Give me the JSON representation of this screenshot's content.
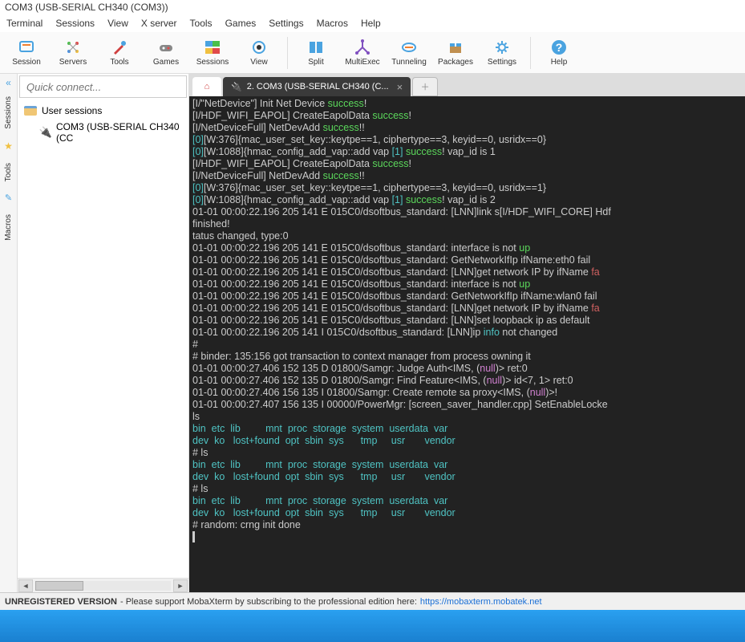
{
  "title": "COM3  (USB-SERIAL CH340 (COM3))",
  "menubar": [
    "Terminal",
    "Sessions",
    "View",
    "X server",
    "Tools",
    "Games",
    "Settings",
    "Macros",
    "Help"
  ],
  "toolbar": [
    {
      "label": "Session",
      "name": "session-button"
    },
    {
      "label": "Servers",
      "name": "servers-button"
    },
    {
      "label": "Tools",
      "name": "tools-button"
    },
    {
      "label": "Games",
      "name": "games-button"
    },
    {
      "label": "Sessions",
      "name": "sessions-button"
    },
    {
      "label": "View",
      "name": "view-button"
    },
    {
      "label": "Split",
      "name": "split-button"
    },
    {
      "label": "MultiExec",
      "name": "multiexec-button"
    },
    {
      "label": "Tunneling",
      "name": "tunneling-button"
    },
    {
      "label": "Packages",
      "name": "packages-button"
    },
    {
      "label": "Settings",
      "name": "settings-button"
    },
    {
      "label": "Help",
      "name": "help-button"
    }
  ],
  "quickconnect_placeholder": "Quick connect...",
  "sidetabs": [
    "Sessions",
    "Tools",
    "Macros"
  ],
  "tree": {
    "root": "User sessions",
    "child": "COM3  (USB-SERIAL CH340 (CC"
  },
  "tabs": {
    "active": "2. COM3  (USB-SERIAL CH340 (C..."
  },
  "terminal_lines": [
    [
      {
        "t": "[I/\"NetDevice\"] Init Net Device "
      },
      {
        "t": "success",
        "c": "g"
      },
      {
        "t": "!"
      }
    ],
    [
      {
        "t": "[I/HDF_WIFI_EAPOL] CreateEapolData "
      },
      {
        "t": "success",
        "c": "g"
      },
      {
        "t": "!"
      }
    ],
    [
      {
        "t": "[I/NetDeviceFull] NetDevAdd "
      },
      {
        "t": "success",
        "c": "g"
      },
      {
        "t": "!!"
      }
    ],
    [
      {
        "t": "[0]",
        "c": "c"
      },
      {
        "t": "[W:376]{mac_user_set_key::keytpe==1, ciphertype==3, keyid==0, usridx==0}"
      }
    ],
    [
      {
        "t": "[0]",
        "c": "c"
      },
      {
        "t": "[W:1088]{hmac_config_add_vap::add vap "
      },
      {
        "t": "[1]",
        "c": "c"
      },
      {
        "t": " "
      },
      {
        "t": "success",
        "c": "g"
      },
      {
        "t": "! vap_id is 1"
      }
    ],
    [
      {
        "t": "[I/HDF_WIFI_EAPOL] CreateEapolData "
      },
      {
        "t": "success",
        "c": "g"
      },
      {
        "t": "!"
      }
    ],
    [
      {
        "t": "[I/NetDeviceFull] NetDevAdd "
      },
      {
        "t": "success",
        "c": "g"
      },
      {
        "t": "!!"
      }
    ],
    [
      {
        "t": "[0]",
        "c": "c"
      },
      {
        "t": "[W:376]{mac_user_set_key::keytpe==1, ciphertype==3, keyid==0, usridx==1}"
      }
    ],
    [
      {
        "t": "[0]",
        "c": "c"
      },
      {
        "t": "[W:1088]{hmac_config_add_vap::add vap "
      },
      {
        "t": "[1]",
        "c": "c"
      },
      {
        "t": " "
      },
      {
        "t": "success",
        "c": "g"
      },
      {
        "t": "! vap_id is 2"
      }
    ],
    [
      {
        "t": "01-01 00:00:22.196 205 141 E 015C0/dsoftbus_standard: [LNN]link s[I/HDF_WIFI_CORE] Hdf"
      }
    ],
    [
      {
        "t": "finished!"
      }
    ],
    [
      {
        "t": "tatus changed, type:0"
      }
    ],
    [
      {
        "t": "01-01 00:00:22.196 205 141 E 015C0/dsoftbus_standard: interface is not "
      },
      {
        "t": "up",
        "c": "g"
      }
    ],
    [
      {
        "t": "01-01 00:00:22.196 205 141 E 015C0/dsoftbus_standard: GetNetworkIfIp ifName:eth0 fail"
      }
    ],
    [
      {
        "t": "01-01 00:00:22.196 205 141 E 015C0/dsoftbus_standard: [LNN]get network IP by ifName "
      },
      {
        "t": "fa",
        "c": "r"
      }
    ],
    [
      {
        "t": "01-01 00:00:22.196 205 141 E 015C0/dsoftbus_standard: interface is not "
      },
      {
        "t": "up",
        "c": "g"
      }
    ],
    [
      {
        "t": "01-01 00:00:22.196 205 141 E 015C0/dsoftbus_standard: GetNetworkIfIp ifName:wlan0 fail"
      }
    ],
    [
      {
        "t": "01-01 00:00:22.196 205 141 E 015C0/dsoftbus_standard: [LNN]get network IP by ifName "
      },
      {
        "t": "fa",
        "c": "r"
      }
    ],
    [
      {
        "t": "01-01 00:00:22.196 205 141 E 015C0/dsoftbus_standard: [LNN]set loopback ip as default "
      }
    ],
    [
      {
        "t": ""
      }
    ],
    [
      {
        "t": "01-01 00:00:22.196 205 141 I 015C0/dsoftbus_standard: [LNN]ip "
      },
      {
        "t": "info",
        "c": "c"
      },
      {
        "t": " not changed"
      }
    ],
    [
      {
        "t": ""
      }
    ],
    [
      {
        "t": ""
      }
    ],
    [
      {
        "t": "#"
      }
    ],
    [
      {
        "t": "# binder: 135:156 got transaction to context manager from process owning it"
      }
    ],
    [
      {
        "t": "01-01 00:00:27.406 152 135 D 01800/Samgr: Judge Auth<IMS, ("
      },
      {
        "t": "null",
        "c": "m"
      },
      {
        "t": ")> ret:0"
      }
    ],
    [
      {
        "t": "01-01 00:00:27.406 152 135 D 01800/Samgr: Find Feature<IMS, ("
      },
      {
        "t": "null",
        "c": "m"
      },
      {
        "t": ")> id<7, 1> ret:0"
      }
    ],
    [
      {
        "t": "01-01 00:00:27.406 156 135 I 01800/Samgr: Create remote sa proxy<IMS, ("
      },
      {
        "t": "null",
        "c": "m"
      },
      {
        "t": ")>!"
      }
    ],
    [
      {
        "t": "01-01 00:00:27.407 156 135 I 00000/PowerMgr: [screen_saver_handler.cpp] SetEnableLocke"
      }
    ],
    [
      {
        "t": "ls"
      }
    ],
    [
      {
        "t": "bin",
        "c": "c"
      },
      {
        "t": "  "
      },
      {
        "t": "etc",
        "c": "c"
      },
      {
        "t": "  "
      },
      {
        "t": "lib",
        "c": "c"
      },
      {
        "t": "         "
      },
      {
        "t": "mnt",
        "c": "c"
      },
      {
        "t": "  "
      },
      {
        "t": "proc",
        "c": "c"
      },
      {
        "t": "  "
      },
      {
        "t": "storage",
        "c": "c"
      },
      {
        "t": "  "
      },
      {
        "t": "system",
        "c": "c"
      },
      {
        "t": "  "
      },
      {
        "t": "userdata",
        "c": "c"
      },
      {
        "t": "  "
      },
      {
        "t": "var",
        "c": "c"
      }
    ],
    [
      {
        "t": "dev",
        "c": "c"
      },
      {
        "t": "  "
      },
      {
        "t": "ko",
        "c": "c"
      },
      {
        "t": "   "
      },
      {
        "t": "lost+found",
        "c": "c"
      },
      {
        "t": "  "
      },
      {
        "t": "opt",
        "c": "c"
      },
      {
        "t": "  "
      },
      {
        "t": "sbin",
        "c": "c"
      },
      {
        "t": "  "
      },
      {
        "t": "sys",
        "c": "c"
      },
      {
        "t": "      "
      },
      {
        "t": "tmp",
        "c": "c"
      },
      {
        "t": "     "
      },
      {
        "t": "usr",
        "c": "c"
      },
      {
        "t": "       "
      },
      {
        "t": "vendor",
        "c": "c"
      }
    ],
    [
      {
        "t": "# ls"
      }
    ],
    [
      {
        "t": "bin",
        "c": "c"
      },
      {
        "t": "  "
      },
      {
        "t": "etc",
        "c": "c"
      },
      {
        "t": "  "
      },
      {
        "t": "lib",
        "c": "c"
      },
      {
        "t": "         "
      },
      {
        "t": "mnt",
        "c": "c"
      },
      {
        "t": "  "
      },
      {
        "t": "proc",
        "c": "c"
      },
      {
        "t": "  "
      },
      {
        "t": "storage",
        "c": "c"
      },
      {
        "t": "  "
      },
      {
        "t": "system",
        "c": "c"
      },
      {
        "t": "  "
      },
      {
        "t": "userdata",
        "c": "c"
      },
      {
        "t": "  "
      },
      {
        "t": "var",
        "c": "c"
      }
    ],
    [
      {
        "t": "dev",
        "c": "c"
      },
      {
        "t": "  "
      },
      {
        "t": "ko",
        "c": "c"
      },
      {
        "t": "   "
      },
      {
        "t": "lost+found",
        "c": "c"
      },
      {
        "t": "  "
      },
      {
        "t": "opt",
        "c": "c"
      },
      {
        "t": "  "
      },
      {
        "t": "sbin",
        "c": "c"
      },
      {
        "t": "  "
      },
      {
        "t": "sys",
        "c": "c"
      },
      {
        "t": "      "
      },
      {
        "t": "tmp",
        "c": "c"
      },
      {
        "t": "     "
      },
      {
        "t": "usr",
        "c": "c"
      },
      {
        "t": "       "
      },
      {
        "t": "vendor",
        "c": "c"
      }
    ],
    [
      {
        "t": "# ls"
      }
    ],
    [
      {
        "t": "bin",
        "c": "c"
      },
      {
        "t": "  "
      },
      {
        "t": "etc",
        "c": "c"
      },
      {
        "t": "  "
      },
      {
        "t": "lib",
        "c": "c"
      },
      {
        "t": "         "
      },
      {
        "t": "mnt",
        "c": "c"
      },
      {
        "t": "  "
      },
      {
        "t": "proc",
        "c": "c"
      },
      {
        "t": "  "
      },
      {
        "t": "storage",
        "c": "c"
      },
      {
        "t": "  "
      },
      {
        "t": "system",
        "c": "c"
      },
      {
        "t": "  "
      },
      {
        "t": "userdata",
        "c": "c"
      },
      {
        "t": "  "
      },
      {
        "t": "var",
        "c": "c"
      }
    ],
    [
      {
        "t": "dev",
        "c": "c"
      },
      {
        "t": "  "
      },
      {
        "t": "ko",
        "c": "c"
      },
      {
        "t": "   "
      },
      {
        "t": "lost+found",
        "c": "c"
      },
      {
        "t": "  "
      },
      {
        "t": "opt",
        "c": "c"
      },
      {
        "t": "  "
      },
      {
        "t": "sbin",
        "c": "c"
      },
      {
        "t": "  "
      },
      {
        "t": "sys",
        "c": "c"
      },
      {
        "t": "      "
      },
      {
        "t": "tmp",
        "c": "c"
      },
      {
        "t": "     "
      },
      {
        "t": "usr",
        "c": "c"
      },
      {
        "t": "       "
      },
      {
        "t": "vendor",
        "c": "c"
      }
    ],
    [
      {
        "t": "# random: crng init done"
      }
    ]
  ],
  "status": {
    "unreg": "UNREGISTERED VERSION",
    "msg": "  -  Please support MobaXterm by subscribing to the professional edition here:  ",
    "link": "https://mobaxterm.mobatek.net"
  }
}
